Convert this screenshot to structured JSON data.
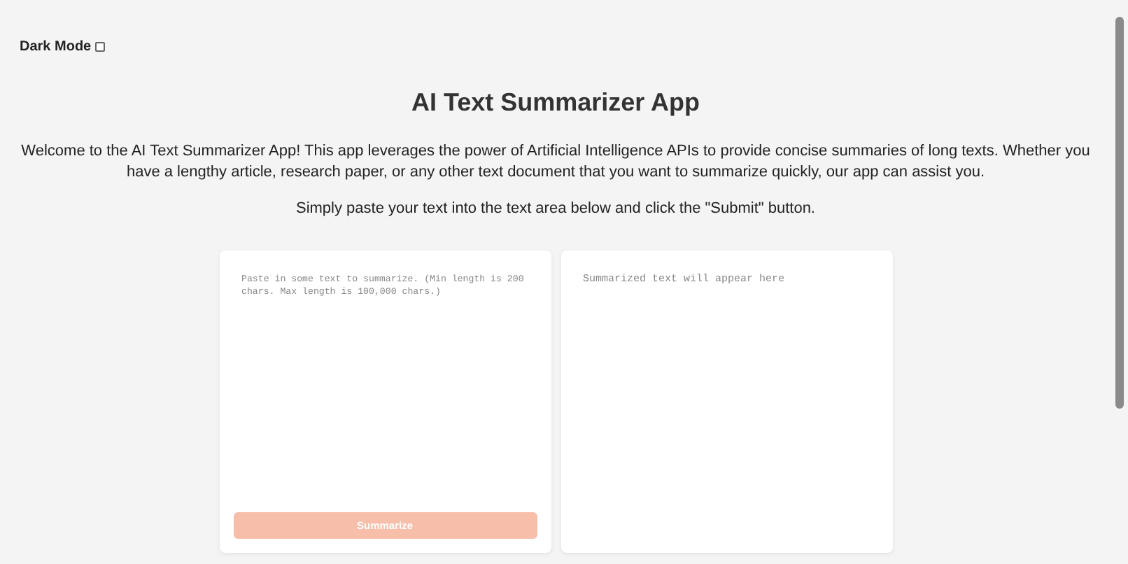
{
  "dark_mode": {
    "label": "Dark Mode",
    "checked": false
  },
  "title": "AI Text Summarizer App",
  "intro": "Welcome to the AI Text Summarizer App! This app leverages the power of Artificial Intelligence APIs to provide concise summaries of long texts. Whether you have a lengthy article, research paper, or any other text document that you want to summarize quickly, our app can assist you.",
  "instructions": "Simply paste your text into the text area below and click the \"Submit\" button.",
  "input": {
    "placeholder": "Paste in some text to summarize. (Min length is 200 chars. Max length is 100,000 chars.)"
  },
  "summarize_button": {
    "label": "Summarize",
    "disabled": true
  },
  "output": {
    "placeholder": "Summarized text will appear here"
  }
}
